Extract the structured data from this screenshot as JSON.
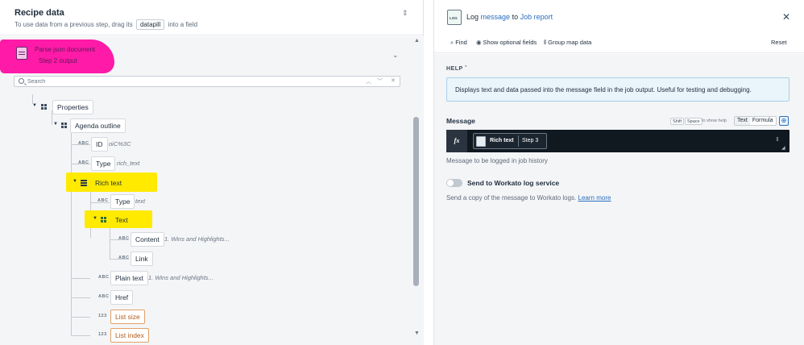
{
  "left": {
    "title": "Recipe data",
    "hint_before": "To use data from a previous step, drag its",
    "hint_pill": "datapill",
    "hint_after": "into a field",
    "source": {
      "name": "Parse json document",
      "step": "Step 2 output",
      "highlight_color": "#ff1aa8"
    },
    "search": {
      "placeholder": "Search"
    },
    "tree": [
      {
        "label": "Properties",
        "kind": "object"
      },
      {
        "label": "Agenda outline",
        "kind": "object"
      },
      {
        "label": "ID",
        "type": "ABC",
        "sample": "oiC%3C"
      },
      {
        "label": "Type",
        "type": "ABC",
        "sample": "rich_text"
      },
      {
        "label": "Rich text",
        "kind": "list"
      },
      {
        "label": "Type",
        "type": "ABC",
        "sample": "text"
      },
      {
        "label": "Text",
        "kind": "object"
      },
      {
        "label": "Content",
        "type": "ABC",
        "sample": "1. Wins and Highlights..."
      },
      {
        "label": "Link",
        "type": "ABC",
        "sample": ""
      },
      {
        "label": "Plain text",
        "type": "ABC",
        "sample": "1. Wins and Highlights..."
      },
      {
        "label": "Href",
        "type": "ABC",
        "sample": ""
      },
      {
        "label": "List size",
        "type": "123",
        "sample": ""
      },
      {
        "label": "List index",
        "type": "123",
        "sample": ""
      }
    ],
    "highlight_color": "#ffea00"
  },
  "right": {
    "title_a": "Log",
    "title_b": "message",
    "title_c": "to",
    "title_d": "Job report",
    "icon_text": "LOG",
    "tools": {
      "find": "Find",
      "optional": "Show optional fields",
      "group": "Group map data",
      "reset": "Reset"
    },
    "help_label": "HELP",
    "help_text": "Displays text and data passed into the message field in the job output. Useful for testing and debugging.",
    "message_label": "Message",
    "kbd_shift": "Shift",
    "kbd_space": "Space",
    "show_help": "to show help",
    "mode_text": "Text",
    "mode_formula": "Formula",
    "fx": "fx",
    "pill_name": "Rich text",
    "pill_step": "Step 3",
    "message_hint": "Message to be logged in job history",
    "switch_label": "Send to Workato log service",
    "switch_desc": "Send a copy of the message to Workato logs.",
    "learn_more": "Learn more"
  }
}
